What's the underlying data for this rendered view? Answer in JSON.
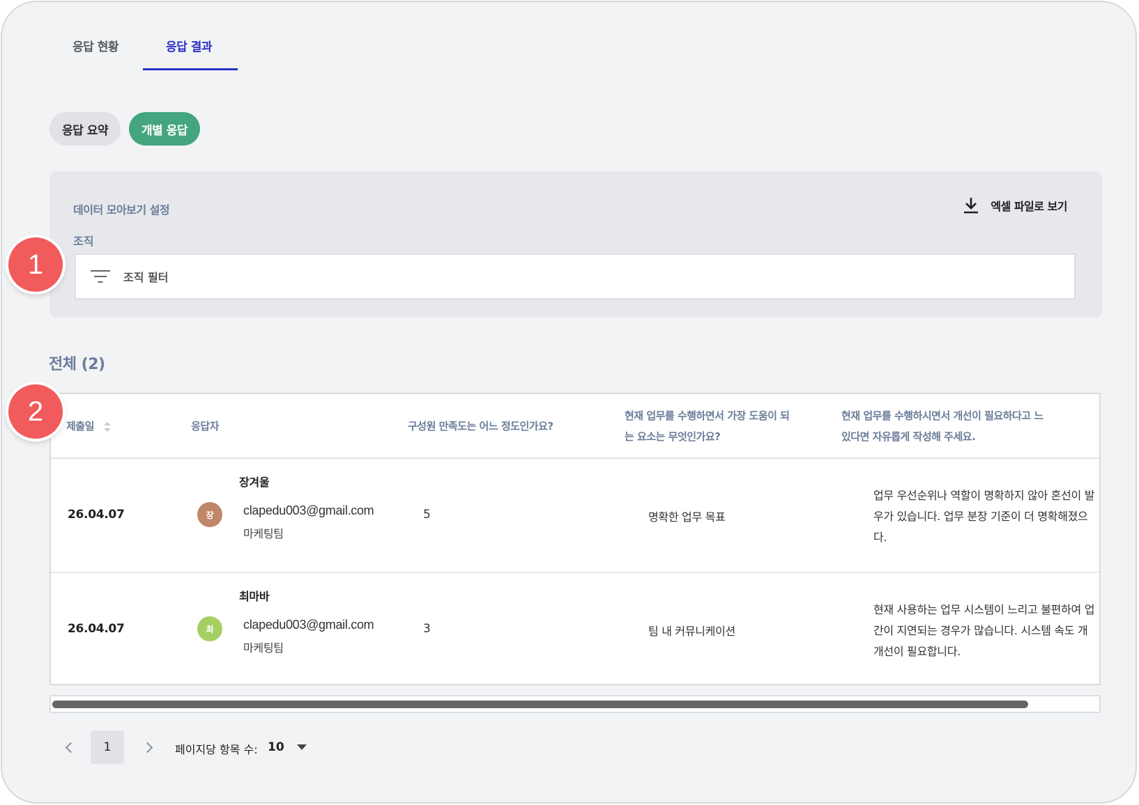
{
  "tabs": {
    "status": "응답 현황",
    "result": "응답 결과"
  },
  "pills": {
    "summary": "응답 요약",
    "individual": "개별 응답"
  },
  "settings": {
    "title": "데이터 모아보기 설정",
    "org_label": "조직",
    "filter_placeholder": "조직 필터",
    "excel_label": "엑셀 파일로 보기"
  },
  "total_label": "전체 (2)",
  "badges": {
    "one": "1",
    "two": "2"
  },
  "table": {
    "headers": {
      "date": "제출일",
      "respondent": "응답자",
      "satisfaction": "구성원 만족도는 어느 정도인가요?",
      "help_line1": "현재 업무를 수행하면서 가장 도움이 되",
      "help_line2": "는 요소는 무엇인가요?",
      "improve_line1": "현재 업무를 수행하시면서 개선이 필요하다고 느",
      "improve_line2": "있다면 자유롭게 작성해 주세요."
    },
    "rows": [
      {
        "date": "26.04.07",
        "avatar": "장",
        "avatar_color": "#c0866a",
        "name": "장겨울",
        "email": "clapedu003@gmail.com",
        "team": "마케팅팀",
        "satisfaction": "5",
        "help": "명확한 업무 목표",
        "improve_line1": "업무 우선순위나 역할이 명확하지 않아 혼선이 발",
        "improve_line2": "우가 있습니다. 업무 분장 기준이 더 명확해졌으",
        "improve_line3": "다."
      },
      {
        "date": "26.04.07",
        "avatar": "최",
        "avatar_color": "#a6cf63",
        "name": "최마바",
        "email": "clapedu003@gmail.com",
        "team": "마케팅팀",
        "satisfaction": "3",
        "help": "팀 내 커뮤니케이션",
        "improve_line1": "현재 사용하는 업무 시스템이 느리고 불편하여 업",
        "improve_line2": "간이 지연되는 경우가 많습니다. 시스템 속도 개",
        "improve_line3": "개선이 필요합니다."
      }
    ]
  },
  "pagination": {
    "page": "1",
    "per_page_label": "페이지당 항목 수:",
    "per_page_value": "10"
  },
  "colors": {
    "accent_blue": "#2a2fc6",
    "accent_green": "#44a57e",
    "badge_red": "#f25b5b"
  }
}
